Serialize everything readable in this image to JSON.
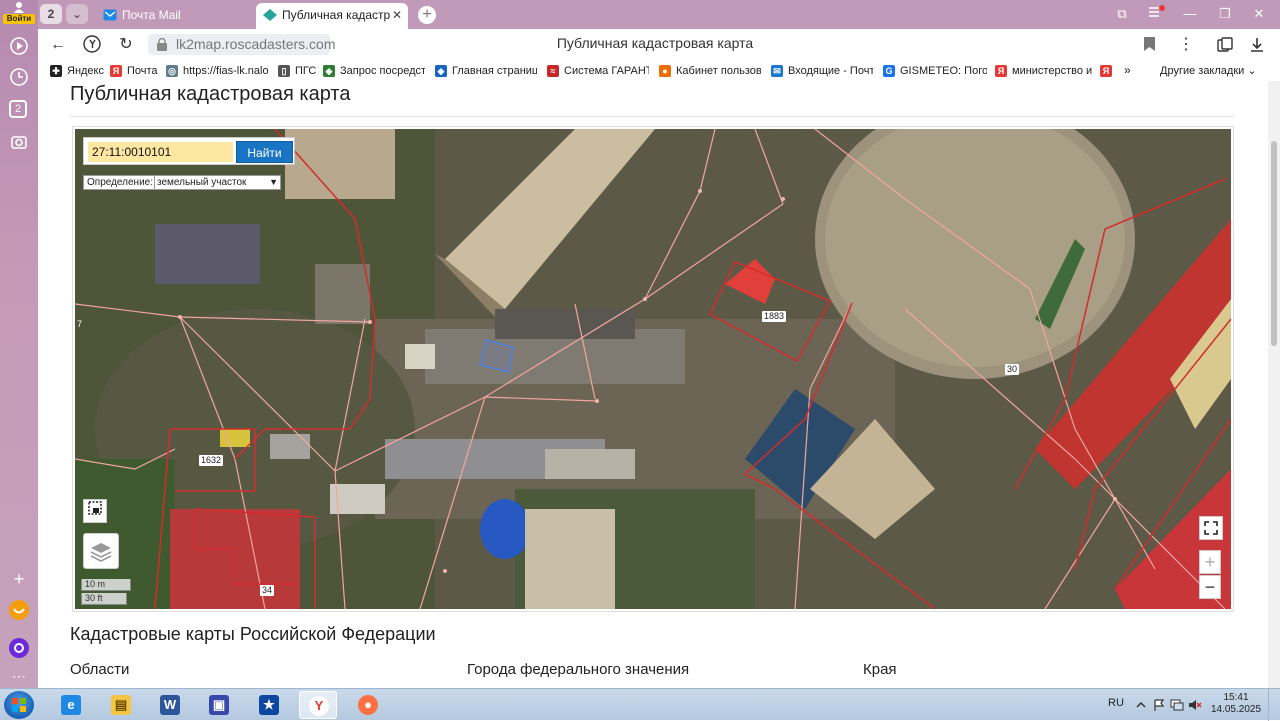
{
  "browser": {
    "login_label": "Войти",
    "rail_badge": "2",
    "tab_counter": "2",
    "tabs": [
      {
        "title": "Почта Mail"
      },
      {
        "title": "Публичная кадастровая карта"
      }
    ],
    "url": "lk2map.roscadasters.com",
    "page_title": "Публичная кадастровая карта"
  },
  "bookmarks": [
    {
      "label": "Яндекс",
      "color": "#222222",
      "glyph": "✚"
    },
    {
      "label": "Почта",
      "color": "#e53935",
      "glyph": "Я"
    },
    {
      "label": "https://fias-lk.nalo",
      "color": "#607d8b",
      "glyph": "◎"
    },
    {
      "label": "ПГС",
      "color": "#555555",
      "glyph": "▯"
    },
    {
      "label": "Запрос посредстве",
      "color": "#2e7d32",
      "glyph": "◈"
    },
    {
      "label": "Главная страница",
      "color": "#1565c0",
      "glyph": "◈"
    },
    {
      "label": "Система ГАРАНТ",
      "color": "#c62828",
      "glyph": "≈"
    },
    {
      "label": "Кабинет пользова",
      "color": "#ef6c00",
      "glyph": "●"
    },
    {
      "label": "Входящие - Почта",
      "color": "#1976d2",
      "glyph": "✉"
    },
    {
      "label": "GISMETEO: Погод",
      "color": "#1a73e8",
      "glyph": "G"
    },
    {
      "label": "министерство и",
      "color": "#e53935",
      "glyph": "Я"
    },
    {
      "label": "",
      "color": "#e53935",
      "glyph": "Я"
    }
  ],
  "bookmarks_more": "»",
  "bookmarks_other": "Другие закладки",
  "page": {
    "heading": "Публичная кадастровая карта",
    "search": {
      "value": "27:11:0010101",
      "button": "Найти"
    },
    "definition": {
      "label": "Определение:",
      "value": "земельный участок"
    },
    "scale": {
      "metric": "10 m",
      "imperial": "30 ft"
    },
    "parcel_labels": [
      "7",
      "1632",
      "1883",
      "30",
      "34"
    ],
    "zoom_in": "+",
    "zoom_out": "−",
    "section_heading": "Кадастровые карты Российской Федерации",
    "columns": [
      "Области",
      "Города федерального значения",
      "Края"
    ]
  },
  "taskbar": {
    "apps": [
      {
        "name": "ie",
        "color": "#1e88e5",
        "glyph": "e"
      },
      {
        "name": "explorer",
        "color": "#f4c542",
        "glyph": "▤"
      },
      {
        "name": "word",
        "color": "#2b579a",
        "glyph": "W"
      },
      {
        "name": "save",
        "color": "#3949ab",
        "glyph": "▣"
      },
      {
        "name": "app-blue",
        "color": "#0d47a1",
        "glyph": "★"
      },
      {
        "name": "yandex",
        "color": "#ffffff",
        "glyph": "Y"
      },
      {
        "name": "firefox",
        "color": "#ff7043",
        "glyph": "●"
      }
    ],
    "lang": "RU",
    "time": "15:41",
    "date": "14.05.2025"
  }
}
